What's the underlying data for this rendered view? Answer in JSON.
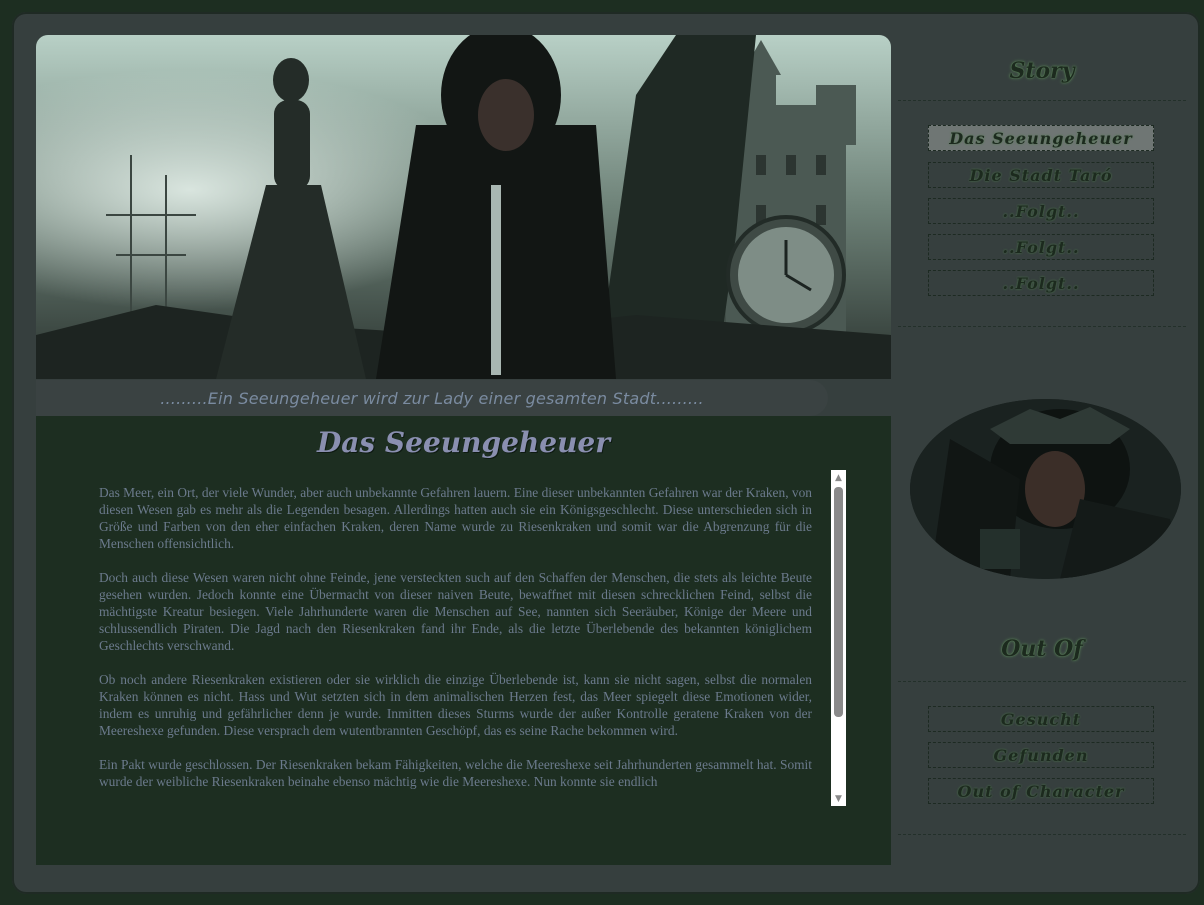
{
  "tagline": ".........Ein Seeungeheuer wird zur Lady einer gesamten Stadt.........",
  "story": {
    "title": "Das Seeungeheuer",
    "paragraphs": [
      "Das Meer, ein Ort, der viele Wunder, aber auch unbekannte Gefahren lauern. Eine dieser unbekannten Gefahren war der Kraken, von diesen Wesen gab es mehr als die Legenden besagen. Allerdings hatten auch sie ein Königsgeschlecht. Diese unterschieden sich in Größe und Farben von den eher einfachen Kraken, deren Name wurde zu Riesenkraken und somit war die Abgrenzung für die Menschen offensichtlich.",
      "Doch auch diese Wesen waren nicht ohne Feinde, jene versteckten such auf den Schaffen der Menschen, die stets als leichte Beute gesehen wurden. Jedoch konnte eine Übermacht von dieser naiven Beute, bewaffnet mit diesen schrecklichen Feind, selbst die mächtigste Kreatur besiegen. Viele Jahrhunderte waren die Menschen auf See, nannten sich Seeräuber, Könige der Meere und schlussendlich Piraten. Die Jagd nach den Riesenkraken fand ihr Ende, als die letzte Überlebende des bekannten königlichem Geschlechts verschwand.",
      "Ob noch andere Riesenkraken existieren oder sie wirklich die einzige Überlebende ist, kann sie nicht sagen, selbst die normalen Kraken können es nicht. Hass und Wut setzten sich in dem animalischen Herzen fest, das Meer spiegelt diese Emotionen wider, indem es unruhig und gefährlicher denn je wurde. Inmitten dieses Sturms wurde der außer Kontrolle geratene Kraken von der Meereshexe gefunden. Diese versprach dem wutentbrannten Geschöpf, das es seine Rache bekommen wird.",
      "Ein Pakt wurde geschlossen. Der Riesenkraken bekam Fähigkeiten, welche die Meereshexe seit Jahrhunderten gesammelt hat. Somit wurde der weibliche Riesenkraken beinahe ebenso mächtig wie die Meereshexe. Nun konnte sie endlich"
    ]
  },
  "scrollbar": {
    "up_icon": "▲",
    "down_icon": "▼"
  },
  "sidebar": {
    "story_heading": "Story",
    "story_items": [
      {
        "label": "Das Seeungeheuer",
        "active": true
      },
      {
        "label": "Die Stadt Taró"
      },
      {
        "label": "..Folgt.."
      },
      {
        "label": "..Folgt.."
      },
      {
        "label": "..Folgt.."
      }
    ],
    "ooc_heading": "Out Of",
    "ooc_items": [
      {
        "label": "Gesucht"
      },
      {
        "label": "Gefunden"
      },
      {
        "label": "Out of Character"
      }
    ]
  },
  "colors": {
    "page_bg": "#1d2e21",
    "frame_bg": "#363f3e",
    "accent_text": "#8a8fb0",
    "body_text": "#6b7a8c"
  }
}
